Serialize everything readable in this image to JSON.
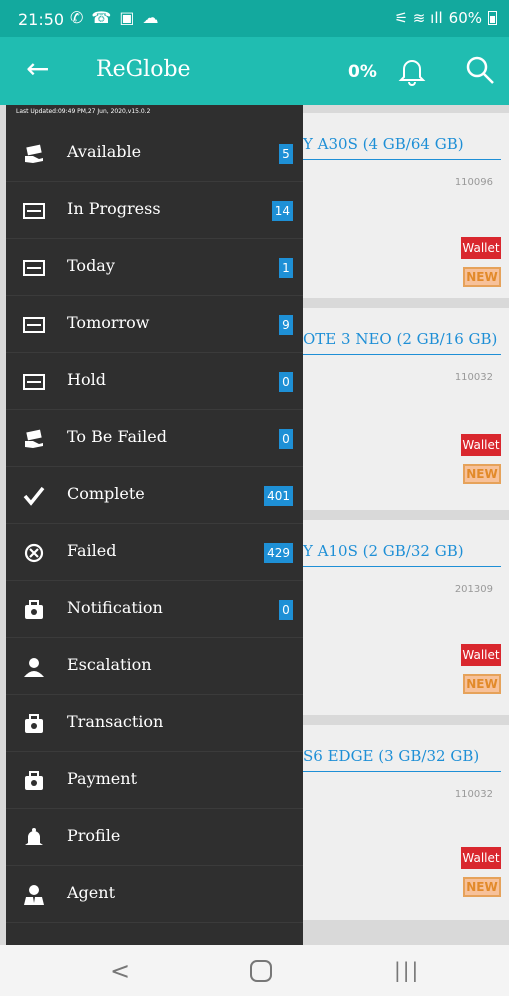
{
  "status_bar": {
    "time": "21:50",
    "battery": "60%"
  },
  "app_bar": {
    "back_icon": "←",
    "title": "ReGlobe",
    "percent": "0%"
  },
  "drawer": {
    "last_updated": "Last Updated:09:49 PM,27 Jun, 2020,v15.0.2",
    "items": [
      {
        "label": "Available",
        "badge": "5",
        "icon": "money-hand-icon"
      },
      {
        "label": "In Progress",
        "badge": "14",
        "icon": "card-icon"
      },
      {
        "label": "Today",
        "badge": "1",
        "icon": "card-icon"
      },
      {
        "label": "Tomorrow",
        "badge": "9",
        "icon": "card-icon"
      },
      {
        "label": "Hold",
        "badge": "0",
        "icon": "card-icon"
      },
      {
        "label": "To Be Failed",
        "badge": "0",
        "icon": "money-hand-icon"
      },
      {
        "label": "Complete",
        "badge": "401",
        "icon": "checkmark-icon"
      },
      {
        "label": "Failed",
        "badge": "429",
        "icon": "cross-circle-icon"
      },
      {
        "label": "Notification",
        "badge": "0",
        "icon": "briefcase-icon"
      },
      {
        "label": "Escalation",
        "badge": "",
        "icon": "person-icon"
      },
      {
        "label": "Transaction",
        "badge": "",
        "icon": "briefcase-icon"
      },
      {
        "label": "Payment",
        "badge": "",
        "icon": "briefcase-icon"
      },
      {
        "label": "Profile",
        "badge": "",
        "icon": "bell-person-icon"
      },
      {
        "label": "Agent",
        "badge": "",
        "icon": "agent-icon"
      }
    ]
  },
  "cards": [
    {
      "title": "Y A30S (4 GB/64 GB)",
      "id": "110096",
      "wallet": "Wallet",
      "new": "NEW"
    },
    {
      "title": "OTE 3 NEO (2 GB/16 GB)",
      "id": "110032",
      "wallet": "Wallet",
      "new": "NEW"
    },
    {
      "title": "Y A10S (2 GB/32 GB)",
      "id": "201309",
      "wallet": "Wallet",
      "new": "NEW"
    },
    {
      "title": "S6 EDGE (3 GB/32 GB)",
      "id": "110032",
      "wallet": "Wallet",
      "new": "NEW"
    }
  ],
  "colors": {
    "teal": "#20bdb1",
    "dark_teal": "#13a99e",
    "drawer": "#2f2f2f",
    "badge": "#1e90d6",
    "wallet": "#d9272e"
  }
}
